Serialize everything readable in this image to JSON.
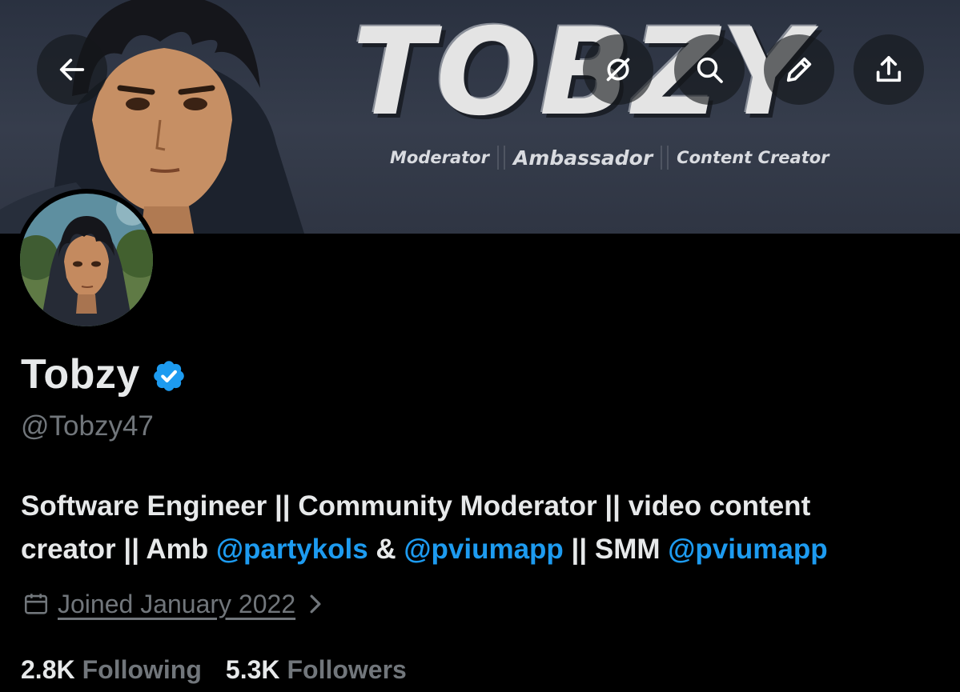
{
  "banner": {
    "title": "TOBZY",
    "tagline": [
      "Moderator",
      "Ambassador",
      "Content Creator"
    ]
  },
  "toolbar": {
    "back_icon": "arrow-left-icon",
    "grok_icon": "grok-icon",
    "search_icon": "search-icon",
    "edit_icon": "pencil-icon",
    "share_icon": "share-icon"
  },
  "profile": {
    "display_name": "Tobzy",
    "handle": "@Tobzy47",
    "verified_color": "#1d9bf0",
    "bio": {
      "line1": "Software Engineer || Community Moderator || video content",
      "line2_prefix": "creator || Amb ",
      "mention1": "@partykols",
      "joiner1": " & ",
      "mention2": "@pviumapp",
      "joiner2": " || SMM ",
      "mention3": "@pviumapp"
    },
    "joined": "Joined January 2022",
    "following_count": "2.8K",
    "following_label": "Following",
    "followers_count": "5.3K",
    "followers_label": "Followers"
  },
  "colors": {
    "background": "#000000",
    "text_primary": "#e7e9ea",
    "text_secondary": "#71767b",
    "accent": "#1d9bf0"
  }
}
